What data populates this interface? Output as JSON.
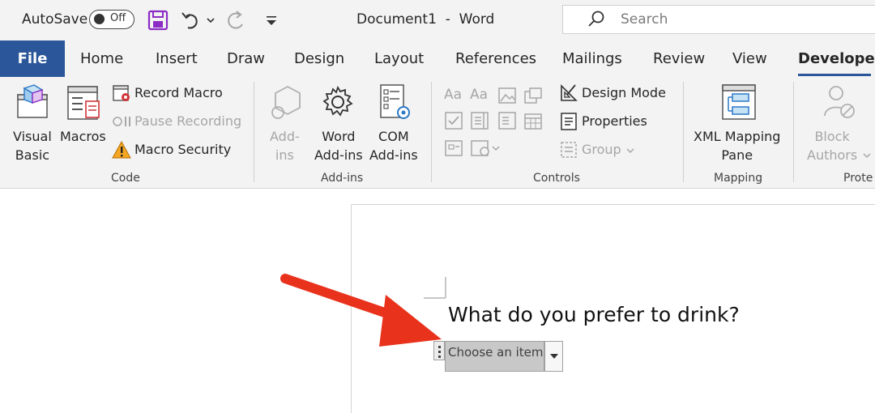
{
  "titlebar": {
    "autosave_label": "AutoSave",
    "autosave_state": "Off",
    "document_title": "Document1  -  Word",
    "search_placeholder": "Search"
  },
  "tabs": [
    {
      "label": "File"
    },
    {
      "label": "Home"
    },
    {
      "label": "Insert"
    },
    {
      "label": "Draw"
    },
    {
      "label": "Design"
    },
    {
      "label": "Layout"
    },
    {
      "label": "References"
    },
    {
      "label": "Mailings"
    },
    {
      "label": "Review"
    },
    {
      "label": "View"
    },
    {
      "label": "Developer",
      "active": true
    }
  ],
  "ribbon": {
    "code": {
      "group_label": "Code",
      "visual_basic": [
        "Visual",
        "Basic"
      ],
      "macros": "Macros",
      "record_macro": "Record Macro",
      "pause_recording": "Pause Recording",
      "macro_security": "Macro Security"
    },
    "addins": {
      "group_label": "Add-ins",
      "addins": [
        "Add-",
        "ins"
      ],
      "word_addins": [
        "Word",
        "Add-ins"
      ],
      "com_addins": [
        "COM",
        "Add-ins"
      ]
    },
    "controls": {
      "group_label": "Controls",
      "design_mode": "Design Mode",
      "properties": "Properties",
      "group": "Group"
    },
    "mapping": {
      "group_label": "Mapping",
      "xml_mapping_pane": [
        "XML Mapping",
        "Pane"
      ]
    },
    "protect": {
      "group_label": "Prote",
      "block_authors": [
        "Block",
        "Authors"
      ]
    }
  },
  "document": {
    "question": "What do you prefer to drink?",
    "dropdown_placeholder": "Choose an item."
  },
  "colors": {
    "word_blue": "#2b579a",
    "ribbon_bg": "#f3f3f3",
    "arrow_red": "#e8321c",
    "control_gray": "#c8c8c8"
  }
}
